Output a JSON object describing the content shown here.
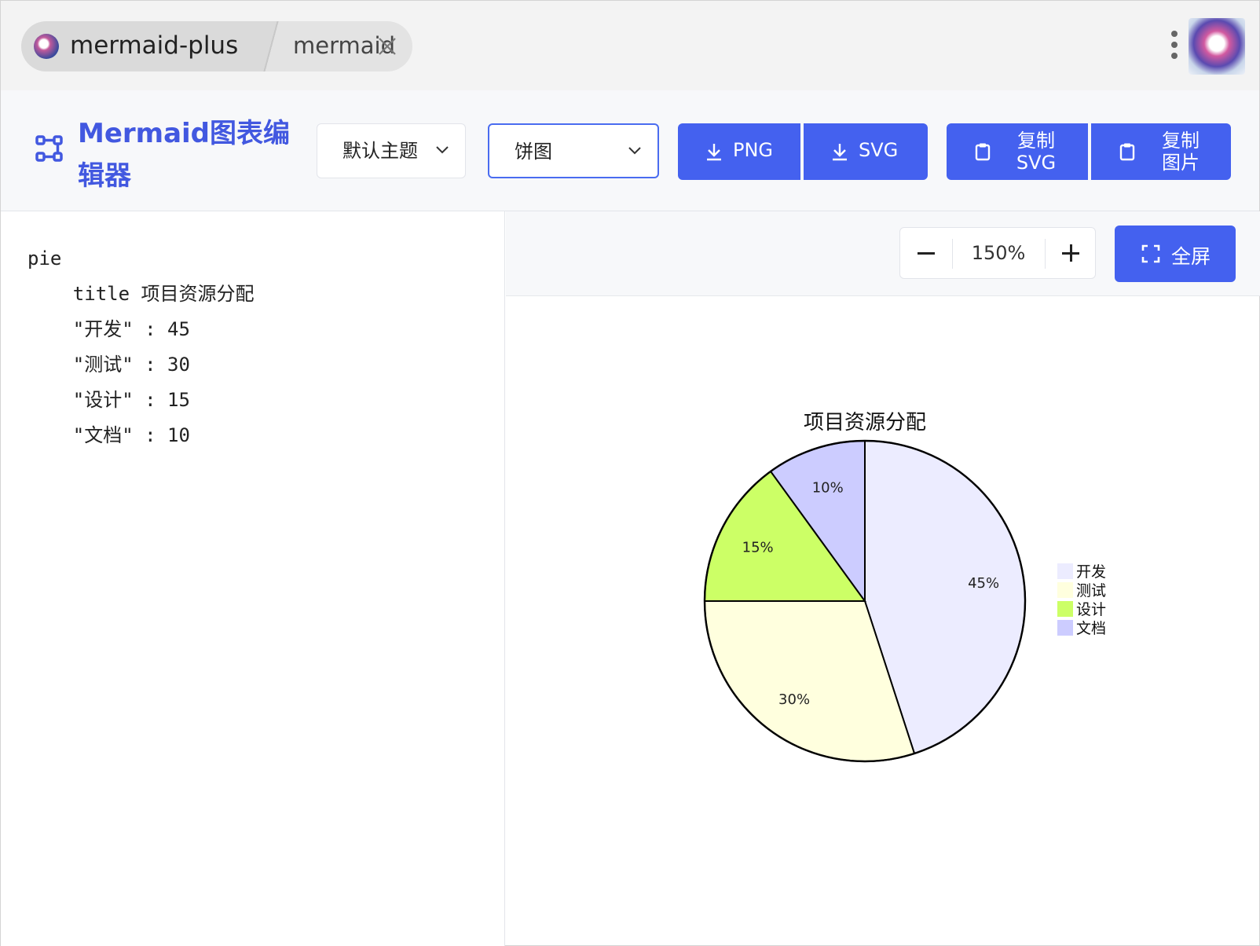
{
  "titlebar": {
    "tabs": [
      {
        "label": "mermaid-plus",
        "active": true
      },
      {
        "label": "mermaid",
        "active": false
      }
    ]
  },
  "toolbar": {
    "app_title": "Mermaid图表编辑器",
    "theme_select": "默认主题",
    "type_select": "饼图",
    "png_button": "PNG",
    "svg_button": "SVG",
    "copy_svg_button": [
      "复制",
      "SVG"
    ],
    "copy_image_button": [
      "复制",
      "图片"
    ],
    "accent_color": "#4461ef"
  },
  "editor": {
    "lines": [
      "pie",
      "    title 项目资源分配",
      "    \"开发\" : 45",
      "    \"测试\" : 30",
      "    \"设计\" : 15",
      "    \"文档\" : 10"
    ]
  },
  "preview": {
    "zoom": "150%",
    "fullscreen_label": "全屏"
  },
  "chart_data": {
    "type": "pie",
    "title": "项目资源分配",
    "categories": [
      "开发",
      "测试",
      "设计",
      "文档"
    ],
    "values": [
      45,
      30,
      15,
      10
    ],
    "labels": [
      "45%",
      "30%",
      "15%",
      "10%"
    ],
    "colors": [
      "#ececff",
      "#ffffde",
      "#ccff66",
      "#ccccff"
    ],
    "legend_position": "right"
  }
}
